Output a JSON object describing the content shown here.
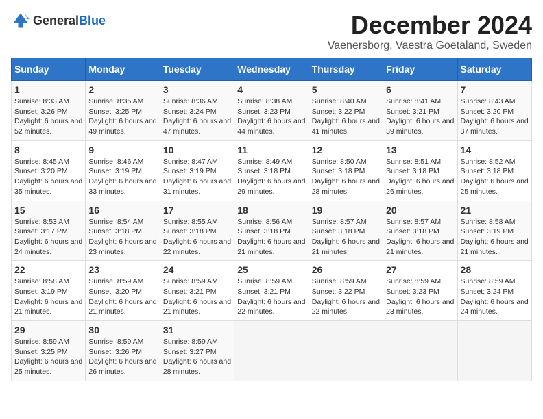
{
  "header": {
    "logo_general": "General",
    "logo_blue": "Blue",
    "month_title": "December 2024",
    "location": "Vaenersborg, Vaestra Goetaland, Sweden"
  },
  "weekdays": [
    "Sunday",
    "Monday",
    "Tuesday",
    "Wednesday",
    "Thursday",
    "Friday",
    "Saturday"
  ],
  "weeks": [
    [
      {
        "day": "1",
        "sunrise": "8:33 AM",
        "sunset": "3:26 PM",
        "daylight": "6 hours and 52 minutes."
      },
      {
        "day": "2",
        "sunrise": "8:35 AM",
        "sunset": "3:25 PM",
        "daylight": "6 hours and 49 minutes."
      },
      {
        "day": "3",
        "sunrise": "8:36 AM",
        "sunset": "3:24 PM",
        "daylight": "6 hours and 47 minutes."
      },
      {
        "day": "4",
        "sunrise": "8:38 AM",
        "sunset": "3:23 PM",
        "daylight": "6 hours and 44 minutes."
      },
      {
        "day": "5",
        "sunrise": "8:40 AM",
        "sunset": "3:22 PM",
        "daylight": "6 hours and 41 minutes."
      },
      {
        "day": "6",
        "sunrise": "8:41 AM",
        "sunset": "3:21 PM",
        "daylight": "6 hours and 39 minutes."
      },
      {
        "day": "7",
        "sunrise": "8:43 AM",
        "sunset": "3:20 PM",
        "daylight": "6 hours and 37 minutes."
      }
    ],
    [
      {
        "day": "8",
        "sunrise": "8:45 AM",
        "sunset": "3:20 PM",
        "daylight": "6 hours and 35 minutes."
      },
      {
        "day": "9",
        "sunrise": "8:46 AM",
        "sunset": "3:19 PM",
        "daylight": "6 hours and 33 minutes."
      },
      {
        "day": "10",
        "sunrise": "8:47 AM",
        "sunset": "3:19 PM",
        "daylight": "6 hours and 31 minutes."
      },
      {
        "day": "11",
        "sunrise": "8:49 AM",
        "sunset": "3:18 PM",
        "daylight": "6 hours and 29 minutes."
      },
      {
        "day": "12",
        "sunrise": "8:50 AM",
        "sunset": "3:18 PM",
        "daylight": "6 hours and 28 minutes."
      },
      {
        "day": "13",
        "sunrise": "8:51 AM",
        "sunset": "3:18 PM",
        "daylight": "6 hours and 26 minutes."
      },
      {
        "day": "14",
        "sunrise": "8:52 AM",
        "sunset": "3:18 PM",
        "daylight": "6 hours and 25 minutes."
      }
    ],
    [
      {
        "day": "15",
        "sunrise": "8:53 AM",
        "sunset": "3:17 PM",
        "daylight": "6 hours and 24 minutes."
      },
      {
        "day": "16",
        "sunrise": "8:54 AM",
        "sunset": "3:18 PM",
        "daylight": "6 hours and 23 minutes."
      },
      {
        "day": "17",
        "sunrise": "8:55 AM",
        "sunset": "3:18 PM",
        "daylight": "6 hours and 22 minutes."
      },
      {
        "day": "18",
        "sunrise": "8:56 AM",
        "sunset": "3:18 PM",
        "daylight": "6 hours and 21 minutes."
      },
      {
        "day": "19",
        "sunrise": "8:57 AM",
        "sunset": "3:18 PM",
        "daylight": "6 hours and 21 minutes."
      },
      {
        "day": "20",
        "sunrise": "8:57 AM",
        "sunset": "3:18 PM",
        "daylight": "6 hours and 21 minutes."
      },
      {
        "day": "21",
        "sunrise": "8:58 AM",
        "sunset": "3:19 PM",
        "daylight": "6 hours and 21 minutes."
      }
    ],
    [
      {
        "day": "22",
        "sunrise": "8:58 AM",
        "sunset": "3:19 PM",
        "daylight": "6 hours and 21 minutes."
      },
      {
        "day": "23",
        "sunrise": "8:59 AM",
        "sunset": "3:20 PM",
        "daylight": "6 hours and 21 minutes."
      },
      {
        "day": "24",
        "sunrise": "8:59 AM",
        "sunset": "3:21 PM",
        "daylight": "6 hours and 21 minutes."
      },
      {
        "day": "25",
        "sunrise": "8:59 AM",
        "sunset": "3:21 PM",
        "daylight": "6 hours and 22 minutes."
      },
      {
        "day": "26",
        "sunrise": "8:59 AM",
        "sunset": "3:22 PM",
        "daylight": "6 hours and 22 minutes."
      },
      {
        "day": "27",
        "sunrise": "8:59 AM",
        "sunset": "3:23 PM",
        "daylight": "6 hours and 23 minutes."
      },
      {
        "day": "28",
        "sunrise": "8:59 AM",
        "sunset": "3:24 PM",
        "daylight": "6 hours and 24 minutes."
      }
    ],
    [
      {
        "day": "29",
        "sunrise": "8:59 AM",
        "sunset": "3:25 PM",
        "daylight": "6 hours and 25 minutes."
      },
      {
        "day": "30",
        "sunrise": "8:59 AM",
        "sunset": "3:26 PM",
        "daylight": "6 hours and 26 minutes."
      },
      {
        "day": "31",
        "sunrise": "8:59 AM",
        "sunset": "3:27 PM",
        "daylight": "6 hours and 28 minutes."
      },
      null,
      null,
      null,
      null
    ]
  ],
  "labels": {
    "sunrise_prefix": "Sunrise: ",
    "sunset_prefix": "Sunset: ",
    "daylight_prefix": "Daylight: "
  }
}
